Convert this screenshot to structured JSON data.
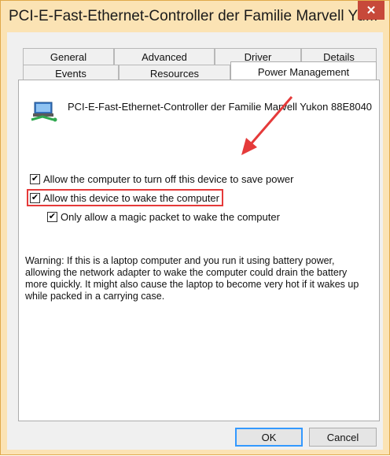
{
  "window": {
    "title": "PCI-E-Fast-Ethernet-Controller der Familie Marvell Yu...",
    "close_glyph": "✕"
  },
  "tabs": {
    "row_back": [
      "General",
      "Advanced",
      "Driver",
      "Details"
    ],
    "row_front": [
      "Events",
      "Resources",
      "Power Management"
    ],
    "active": "Power Management"
  },
  "device": {
    "icon": "network-adapter-icon",
    "name": "PCI-E-Fast-Ethernet-Controller der Familie Marvell Yukon 88E8040"
  },
  "options": [
    {
      "label": "Allow the computer to turn off this device to save power",
      "checked": true
    },
    {
      "label": "Allow this device to wake the computer",
      "checked": true
    },
    {
      "label": "Only allow a magic packet to wake the computer",
      "checked": true
    }
  ],
  "warning_text": "Warning: If this is a laptop computer and you run it using battery power, allowing the network adapter to wake the computer could drain the battery more quickly. It might also cause the laptop to become very hot if it wakes up while packed in a carrying case.",
  "buttons": {
    "ok": "OK",
    "cancel": "Cancel"
  },
  "colors": {
    "accent_frame": "#fbe3b4",
    "close": "#c7493a",
    "annotation": "#e53a3a"
  }
}
